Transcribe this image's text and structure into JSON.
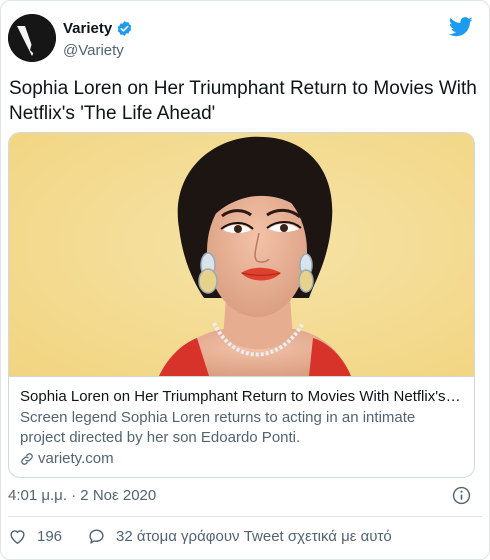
{
  "author": {
    "name": "Variety",
    "handle": "@Variety",
    "verified": true,
    "avatar_letter": "V"
  },
  "tweet": {
    "text": "Sophia Loren on Her Triumphant Return to Movies With Netflix's 'The Life Ahead'"
  },
  "card": {
    "title": "Sophia Loren on Her Triumphant Return to Movies With Netflix's 'The Life Ahead'",
    "description": "Screen legend Sophia Loren returns to acting in an intimate project directed by her son Edoardo Ponti.",
    "domain": "variety.com",
    "image_icon": "portrait-photo"
  },
  "meta": {
    "timestamp": "4:01 μ.μ. · 2 Νοε 2020"
  },
  "actions": {
    "like_count": "196",
    "reply_text": "32 άτομα γράφουν Tweet σχετικά με αυτό"
  },
  "colors": {
    "accent": "#1d9bf0",
    "muted": "#536471",
    "like": "#536471"
  },
  "icons": {
    "brand": "twitter-bird-icon",
    "verified": "verified-badge-icon",
    "info": "info-icon",
    "like": "heart-icon",
    "reply": "chat-bubble-icon",
    "link": "link-icon"
  }
}
